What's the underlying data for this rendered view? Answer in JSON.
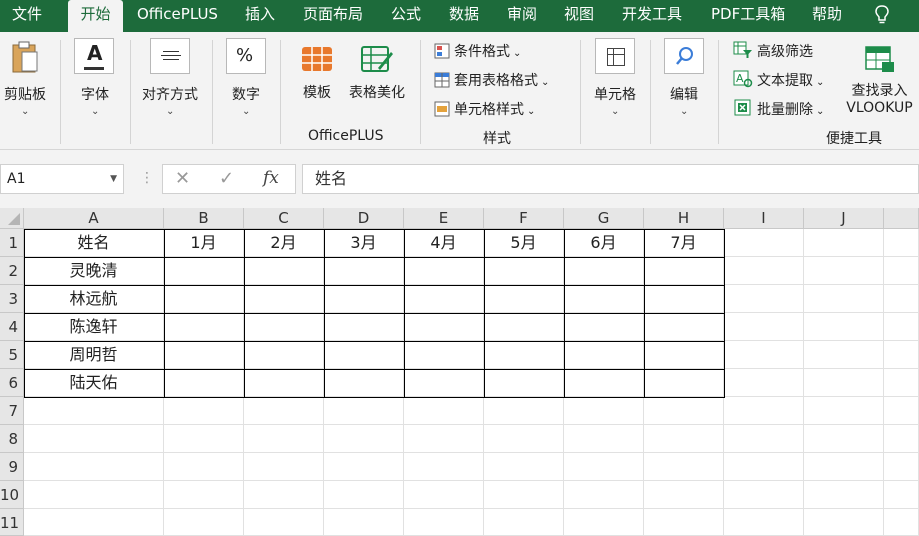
{
  "menu": {
    "tabs": [
      "文件",
      "开始",
      "OfficePLUS",
      "插入",
      "页面布局",
      "公式",
      "数据",
      "审阅",
      "视图",
      "开发工具",
      "PDF工具箱",
      "帮助"
    ],
    "active_tab": "开始"
  },
  "ribbon": {
    "clipboard": "剪贴板",
    "font": "字体",
    "alignment": "对齐方式",
    "number": "数字",
    "template": "模板",
    "table_beautify": "表格美化",
    "officeplus_group": "OfficePLUS",
    "conditional_format": "条件格式",
    "table_style": "套用表格格式",
    "cell_style": "单元格样式",
    "styles_group": "样式",
    "cells": "单元格",
    "edit": "编辑",
    "advanced_filter": "高级筛选",
    "text_extract": "文本提取",
    "batch_delete": "批量删除",
    "lookup_line1": "查找录入",
    "lookup_line2": "VLOOKUP",
    "shortcut_group": "便捷工具"
  },
  "formula_bar": {
    "name_box": "A1",
    "fx": "fx",
    "value": "姓名"
  },
  "sheet": {
    "columns": [
      "A",
      "B",
      "C",
      "D",
      "E",
      "F",
      "G",
      "H",
      "I",
      "J"
    ],
    "rows": [
      "1",
      "2",
      "3",
      "4",
      "5",
      "6",
      "7",
      "8",
      "9",
      "10",
      "11"
    ],
    "header_row": [
      "姓名",
      "1月",
      "2月",
      "3月",
      "4月",
      "5月",
      "6月",
      "7月"
    ],
    "names": [
      "灵晚清",
      "林远航",
      "陈逸轩",
      "周明哲",
      "陆天佑"
    ]
  },
  "colors": {
    "menu_bg": "#1d6b3b",
    "ribbon_bg": "#f3f3f3",
    "header_bg": "#e6e6e6"
  }
}
